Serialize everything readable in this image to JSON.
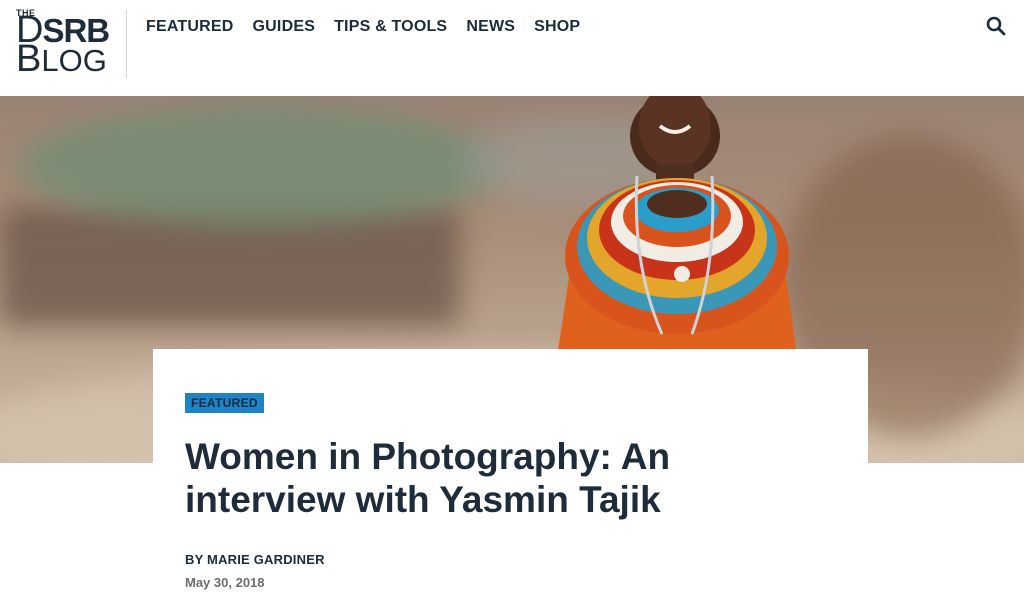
{
  "header": {
    "logo": {
      "the": "THE",
      "line1_prefix": "D",
      "line1_rest": "SRB",
      "line2_prefix": "B",
      "line2_rest": "LOG"
    },
    "nav": [
      "FEATURED",
      "GUIDES",
      "TIPS & TOOLS",
      "NEWS",
      "SHOP"
    ],
    "search_icon": "search-icon"
  },
  "article": {
    "category": "FEATURED",
    "title": "Women in Photography: An interview with Yasmin Tajik",
    "byline": "BY MARIE GARDINER",
    "date": "May 30, 2018"
  },
  "colors": {
    "navy": "#1e2b3a",
    "badge_blue": "#1e84c6",
    "date_gray": "#6d6d6d"
  }
}
